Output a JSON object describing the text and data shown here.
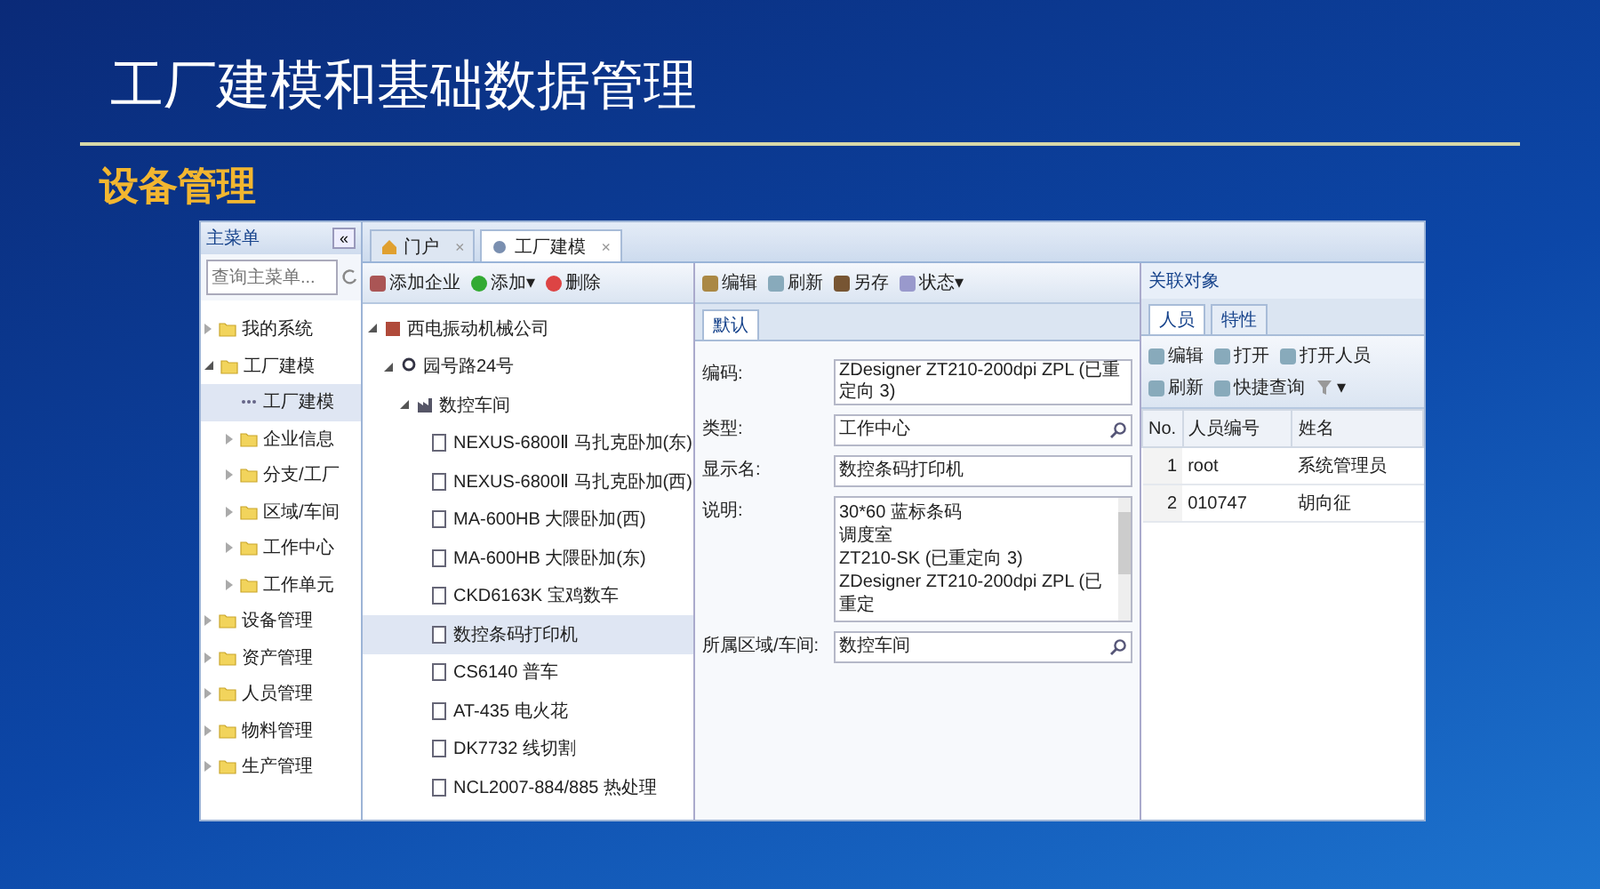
{
  "slide": {
    "title": "工厂建模和基础数据管理",
    "subtitle": "设备管理"
  },
  "sidebar": {
    "title": "主菜单",
    "collapse": "«",
    "search": {
      "placeholder": "查询主菜单..."
    },
    "items": [
      {
        "label": "我的系统",
        "expanded": false,
        "selected": false
      },
      {
        "label": "工厂建模",
        "expanded": true,
        "selected": false,
        "children": [
          {
            "label": "工厂建模",
            "selected": true,
            "kind": "leaf"
          },
          {
            "label": "企业信息",
            "expanded": false,
            "selected": false
          },
          {
            "label": "分支/工厂",
            "expanded": false,
            "selected": false
          },
          {
            "label": "区域/车间",
            "expanded": false,
            "selected": false
          },
          {
            "label": "工作中心",
            "expanded": false,
            "selected": false
          },
          {
            "label": "工作单元",
            "expanded": false,
            "selected": false
          }
        ]
      },
      {
        "label": "设备管理",
        "expanded": false,
        "selected": false
      },
      {
        "label": "资产管理",
        "expanded": false,
        "selected": false
      },
      {
        "label": "人员管理",
        "expanded": false,
        "selected": false
      },
      {
        "label": "物料管理",
        "expanded": false,
        "selected": false
      },
      {
        "label": "生产管理",
        "expanded": false,
        "selected": false
      }
    ]
  },
  "tabs": [
    {
      "label": "门户",
      "close": "×",
      "selected": false
    },
    {
      "label": "工厂建模",
      "close": "×",
      "selected": true
    }
  ],
  "tree_toolbar": [
    "添加企业",
    "添加▾",
    "删除"
  ],
  "tree": [
    {
      "label": "西电振动机械公司",
      "kind": "company",
      "expanded": true,
      "selected": false,
      "children": [
        {
          "label": "园号路24号",
          "kind": "location",
          "expanded": true,
          "selected": false,
          "children": [
            {
              "label": "数控车间",
              "kind": "workshop",
              "expanded": true,
              "selected": false,
              "children": [
                {
                  "label": "NEXUS-6800Ⅱ 马扎克卧加(东)",
                  "kind": "device",
                  "selected": false
                },
                {
                  "label": "NEXUS-6800Ⅱ 马扎克卧加(西)",
                  "kind": "device",
                  "selected": false
                },
                {
                  "label": "MA-600HB 大隈卧加(西)",
                  "kind": "device",
                  "selected": false
                },
                {
                  "label": "MA-600HB 大隈卧加(东)",
                  "kind": "device",
                  "selected": false
                },
                {
                  "label": "CKD6163K 宝鸡数车",
                  "kind": "device",
                  "selected": false
                },
                {
                  "label": "数控条码打印机",
                  "kind": "device",
                  "selected": true
                },
                {
                  "label": "CS6140 普车",
                  "kind": "device",
                  "selected": false
                },
                {
                  "label": "AT-435 电火花",
                  "kind": "device",
                  "selected": false
                },
                {
                  "label": "DK7732 线切割",
                  "kind": "device",
                  "selected": false
                },
                {
                  "label": "NCL2007-884/885 热处理",
                  "kind": "device",
                  "selected": false
                }
              ]
            }
          ]
        }
      ]
    }
  ],
  "detail": {
    "toolbar": [
      "编辑",
      "刷新",
      "另存",
      "状态▾"
    ],
    "tab": "默认",
    "fields": [
      {
        "label": "编码:",
        "kind": "text",
        "value": "ZDesigner ZT210-200dpi ZPL (已重定向 3)"
      },
      {
        "label": "类型:",
        "kind": "lookup",
        "value": "工作中心"
      },
      {
        "label": "显示名:",
        "kind": "text",
        "value": "数控条码打印机"
      },
      {
        "label": "说明:",
        "kind": "textarea",
        "lines": [
          "30*60 蓝标条码",
          "调度室",
          "ZT210-SK (已重定向 3)",
          "ZDesigner ZT210-200dpi ZPL (已重定"
        ]
      },
      {
        "label": "所属区域/车间:",
        "kind": "lookup",
        "value": "数控车间"
      }
    ]
  },
  "related": {
    "title": "关联对象",
    "tabs": [
      {
        "label": "人员",
        "selected": true
      },
      {
        "label": "特性",
        "selected": false
      }
    ],
    "toolbar": [
      "编辑",
      "打开",
      "打开人员",
      "刷新",
      "快捷查询"
    ],
    "filter_caret": "▾",
    "columns": [
      "No.",
      "人员编号",
      "姓名"
    ],
    "rows": [
      [
        "1",
        "root",
        "系统管理员"
      ],
      [
        "2",
        "010747",
        "胡向征"
      ]
    ]
  }
}
